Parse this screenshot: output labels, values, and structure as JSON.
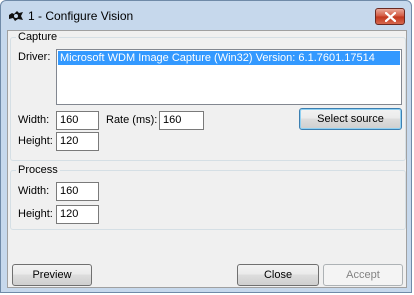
{
  "window": {
    "title": "1 - Configure Vision"
  },
  "capture": {
    "group_label": "Capture",
    "driver_label": "Driver:",
    "drivers": [
      "Microsoft WDM Image Capture (Win32) Version:  6.1.7601.17514"
    ],
    "width_label": "Width:",
    "width_value": "160",
    "height_label": "Height:",
    "height_value": "120",
    "rate_label": "Rate (ms):",
    "rate_value": "160",
    "select_source_label": "Select source"
  },
  "process": {
    "group_label": "Process",
    "width_label": "Width:",
    "width_value": "160",
    "height_label": "Height:",
    "height_value": "120"
  },
  "footer": {
    "preview_label": "Preview",
    "close_label": "Close",
    "accept_label": "Accept"
  },
  "icons": {
    "app": "camera-icon",
    "close": "close-icon"
  }
}
